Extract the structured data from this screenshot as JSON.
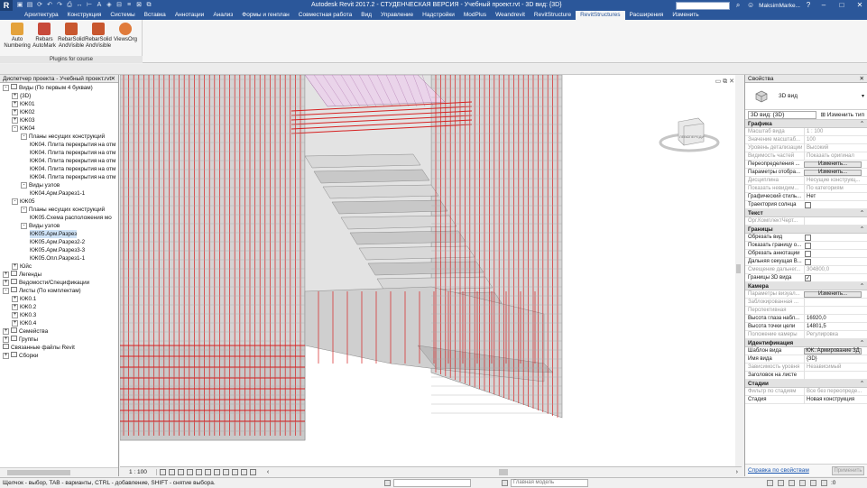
{
  "app": {
    "title": "Autodesk Revit 2017.2 - СТУДЕНЧЕСКАЯ ВЕРСИЯ -   Учебный проект.rvt - 3D вид: {3D}",
    "logo": "R",
    "user": "MaksimMarke...",
    "search_placeholder": ""
  },
  "qat_icons": [
    "open-icon",
    "save-icon",
    "sync-icon",
    "undo-icon",
    "redo-icon",
    "print-icon",
    "measure-icon",
    "dimension-icon",
    "text-icon",
    "3d-view-icon",
    "section-icon",
    "thin-lines-icon",
    "close-hidden-icon",
    "switch-windows-icon"
  ],
  "ribbon": {
    "tabs": [
      "Архитектура",
      "Конструкция",
      "Системы",
      "Вставка",
      "Аннотации",
      "Анализ",
      "Формы и генплан",
      "Совместная работа",
      "Вид",
      "Управление",
      "Надстройки",
      "ModPlus",
      "Weandrevit",
      "RevitStructure",
      "RevitStructures",
      "Расширения",
      "Изменить"
    ],
    "active_tab_index": 14,
    "tools": [
      {
        "line1": "Auto",
        "line2": "Numbering",
        "icon": "auto-numbering-icon"
      },
      {
        "line1": "Rebars",
        "line2": "AutoMark",
        "icon": "rebar-automark-icon"
      },
      {
        "line1": "RebarSolid",
        "line2": "AndVisible",
        "icon": "rebar-solid-icon"
      },
      {
        "line1": "RebarSolid",
        "line2": "AndVisible",
        "icon": "rebar-visible-icon"
      },
      {
        "line1": "ViewsOrg",
        "line2": "",
        "icon": "views-org-icon"
      }
    ],
    "panel_caption": "Plugins for course"
  },
  "browser": {
    "title": "Диспетчер проекта - Учебный проект.rvt",
    "nodes": [
      {
        "text": "Виды (По первым 4 буквам)",
        "level": 0,
        "exp": "-",
        "icon": "views-icon"
      },
      {
        "text": "{3D}",
        "level": 1,
        "exp": "+"
      },
      {
        "text": "КЖ01",
        "level": 1,
        "exp": "+"
      },
      {
        "text": "КЖ02",
        "level": 1,
        "exp": "+"
      },
      {
        "text": "КЖ03",
        "level": 1,
        "exp": "+"
      },
      {
        "text": "КЖ04",
        "level": 1,
        "exp": "-"
      },
      {
        "text": "Планы несущих конструкций",
        "level": 2,
        "exp": "-"
      },
      {
        "text": "КЖ04. Плита перекрытия на отм",
        "level": 3
      },
      {
        "text": "КЖ04. Плита перекрытия на отм",
        "level": 3
      },
      {
        "text": "КЖ04. Плита перекрытия на отм",
        "level": 3
      },
      {
        "text": "КЖ04. Плита перекрытия на отм",
        "level": 3
      },
      {
        "text": "КЖ04. Плита перекрытия на отм",
        "level": 3
      },
      {
        "text": "Виды узлов",
        "level": 2,
        "exp": "-"
      },
      {
        "text": "КЖ04.Арм.Разрез1-1",
        "level": 3
      },
      {
        "text": "КЖ05",
        "level": 1,
        "exp": "-"
      },
      {
        "text": "Планы несущих конструкций",
        "level": 2,
        "exp": "-"
      },
      {
        "text": "КЖ05.Схема расположения мо",
        "level": 3
      },
      {
        "text": "Виды узлов",
        "level": 2,
        "exp": "-"
      },
      {
        "text": "КЖ05.Арм.Разрез",
        "level": 3,
        "selected": true
      },
      {
        "text": "КЖ05.Арм.Разрез2-2",
        "level": 3
      },
      {
        "text": "КЖ05.Арм.Разрез3-3",
        "level": 3
      },
      {
        "text": "КЖ05.Опл.Разрез1-1",
        "level": 3
      },
      {
        "text": "Юйс",
        "level": 1,
        "exp": "+"
      },
      {
        "text": "Легенды",
        "level": 0,
        "exp": "+",
        "icon": "legend-icon"
      },
      {
        "text": "Ведомости/Спецификации",
        "level": 0,
        "exp": "+",
        "icon": "schedule-icon"
      },
      {
        "text": "Листы (По комплектам)",
        "level": 0,
        "exp": "-",
        "icon": "sheets-icon"
      },
      {
        "text": "КЖ0.1",
        "level": 1,
        "exp": "+"
      },
      {
        "text": "КЖ0.2",
        "level": 1,
        "exp": "+"
      },
      {
        "text": "КЖ0.3",
        "level": 1,
        "exp": "+"
      },
      {
        "text": "КЖ0.4",
        "level": 1,
        "exp": "+"
      },
      {
        "text": "Семейства",
        "level": 0,
        "exp": "+",
        "icon": "families-icon"
      },
      {
        "text": "Группы",
        "level": 0,
        "exp": "+",
        "icon": "groups-icon"
      },
      {
        "text": "Связанные файлы Revit",
        "level": 0,
        "exp": "",
        "icon": "links-icon"
      },
      {
        "text": "Сборки",
        "level": 0,
        "exp": "+",
        "icon": "assemblies-icon"
      }
    ]
  },
  "viewcube": {
    "left": "ЛЕВО",
    "front": "СПЕРЕДИ"
  },
  "view_controls": {
    "scale": "1 : 100"
  },
  "properties": {
    "title": "Свойства",
    "type_name": "3D вид",
    "view_selector": "3D вид: {3D}",
    "edit_type": "Изменить тип",
    "groups": [
      {
        "name": "Графика",
        "rows": [
          {
            "k": "Масштаб вида",
            "v": "1 : 100",
            "dis": true
          },
          {
            "k": "Значение масштаб...",
            "v": "100",
            "dis": true
          },
          {
            "k": "Уровень детализации",
            "v": "Высокий",
            "dis": true
          },
          {
            "k": "Видимость частей",
            "v": "Показать оригинал",
            "dis": true
          },
          {
            "k": "Переопределения ...",
            "v": "Изменить...",
            "btn": true
          },
          {
            "k": "Параметры отобра...",
            "v": "Изменить...",
            "btn": true
          },
          {
            "k": "Дисциплина",
            "v": "Несущие конструкц...",
            "dis": true
          },
          {
            "k": "Показать невидим...",
            "v": "По категориям",
            "dis": true
          },
          {
            "k": "Графический стиль...",
            "v": "Нет"
          },
          {
            "k": "Траектория солнца",
            "v": "",
            "chk": "off"
          }
        ]
      },
      {
        "name": "Текст",
        "rows": [
          {
            "k": "Орг.КомплектЧерт...",
            "v": "",
            "dis": true
          }
        ]
      },
      {
        "name": "Границы",
        "rows": [
          {
            "k": "Обрезать вид",
            "v": "",
            "chk": "off"
          },
          {
            "k": "Показать границу о...",
            "v": "",
            "chk": "off"
          },
          {
            "k": "Обрезать аннотации",
            "v": "",
            "chk": "off"
          },
          {
            "k": "Дальняя секущая В...",
            "v": "",
            "chk": "off"
          },
          {
            "k": "Смещение дальнег...",
            "v": "304800,0",
            "dis": true
          },
          {
            "k": "Границы 3D вида",
            "v": "",
            "chk": "on"
          }
        ]
      },
      {
        "name": "Камера",
        "rows": [
          {
            "k": "Параметры визуал...",
            "v": "Изменить...",
            "btn": true,
            "dis": true
          },
          {
            "k": "Заблокированная ...",
            "v": "",
            "dis": true
          },
          {
            "k": "Перспективная",
            "v": "",
            "dis": true
          },
          {
            "k": "Высота глаза набл...",
            "v": "16920,0"
          },
          {
            "k": "Высота точки цели",
            "v": "14801,5"
          },
          {
            "k": "Положение камеры",
            "v": "Регулировка",
            "dis": true
          }
        ]
      },
      {
        "name": "Идентификация",
        "rows": [
          {
            "k": "Шаблон вида",
            "v": "КЖ. Армирование 3Д",
            "btn": true
          },
          {
            "k": "Имя вида",
            "v": "{3D}"
          },
          {
            "k": "Зависимость уровня",
            "v": "Независимый",
            "dis": true
          },
          {
            "k": "Заголовок на листе",
            "v": ""
          }
        ]
      },
      {
        "name": "Стадии",
        "rows": [
          {
            "k": "Фильтр по стадиям",
            "v": "Все без переопреде...",
            "dis": true
          },
          {
            "k": "Стадия",
            "v": "Новая конструкция"
          }
        ]
      }
    ],
    "help_link": "Справка по свойствам",
    "apply": "Применить"
  },
  "status": {
    "message": "Щелчок - выбор, TAB - варианты, CTRL - добавление, SHIFT - снятие выбора.",
    "workset": "",
    "model": "Главная модель",
    "count": ":0"
  },
  "colors": {
    "titlebar": "#2b579a",
    "rebar": "#d62020",
    "concrete": "#d6d6d6",
    "selected": "#cfe3f7"
  }
}
